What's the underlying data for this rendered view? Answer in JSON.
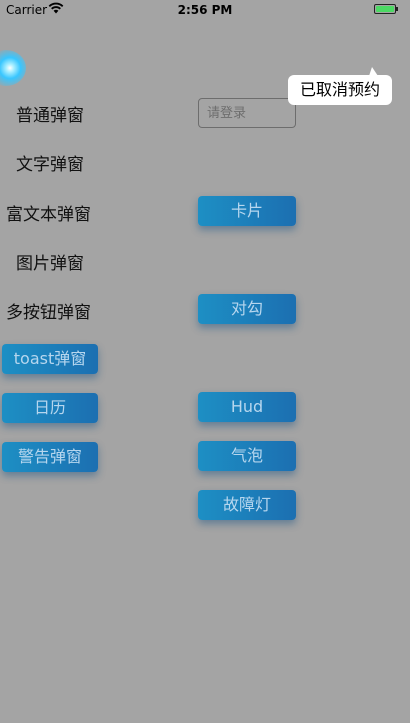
{
  "status_bar": {
    "carrier": "Carrier",
    "time": "2:56 PM",
    "wifi_icon": "wifi-icon",
    "battery_icon": "battery-icon",
    "battery_color": "#4cd964"
  },
  "left_items": {
    "normal": "普通弹窗",
    "text": "文字弹窗",
    "rich_text": "富文本弹窗",
    "image": "图片弹窗",
    "multi_button": "多按钮弹窗",
    "toast": "toast弹窗",
    "calendar": "日历",
    "warning": "警告弹窗"
  },
  "right_items": {
    "card": "卡片",
    "checkmark": "对勾",
    "hud": "Hud",
    "bubble": "气泡",
    "fault_light": "故障灯"
  },
  "login_input": {
    "placeholder": "请登录",
    "value": ""
  },
  "toast_message": "已取消预约",
  "colors": {
    "background": "#a4a4a4",
    "button_start": "#1d8fc4",
    "button_end": "#1c6fb1",
    "button_text": "#b6d6ee"
  }
}
